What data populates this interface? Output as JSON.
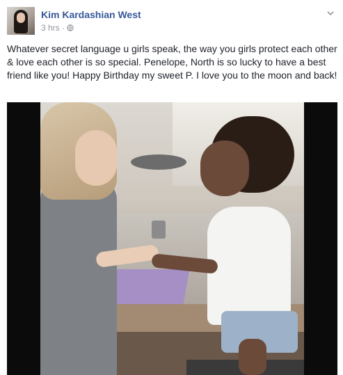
{
  "post": {
    "author": "Kim Kardashian West",
    "time": "3 hrs",
    "separator": "·",
    "privacy_icon": "globe-icon",
    "menu_icon": "chevron-down-icon",
    "text": "Whatever secret language u girls speak, the way you girls protect each other & love each other is so special. Penelope, North is so lucky to have a best friend like you! Happy Birthday my sweet P. I love you to the moon and back!"
  },
  "media": {
    "type": "video",
    "description_icon": "video-frame"
  },
  "colors": {
    "author_link": "#365899",
    "meta_text": "#90949c",
    "body_text": "#1d2129",
    "video_letterbox": "#0b0b0b"
  }
}
